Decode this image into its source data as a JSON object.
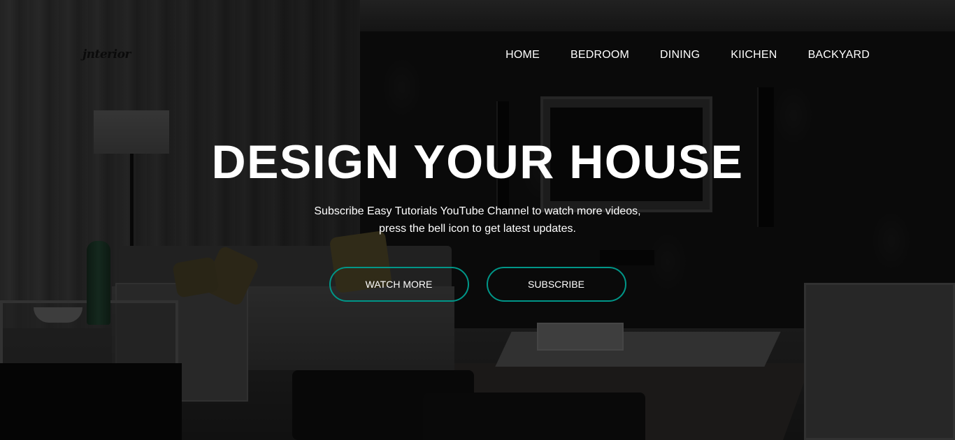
{
  "header": {
    "logo_text": "jnterior",
    "nav": [
      {
        "label": "HOME"
      },
      {
        "label": "BEDROOM"
      },
      {
        "label": "DINING"
      },
      {
        "label": "KIICHEN"
      },
      {
        "label": "BACKYARD"
      }
    ]
  },
  "hero": {
    "title": "DESIGN YOUR HOUSE",
    "subtitle_line1": "Subscribe Easy Tutorials YouTube Channel to watch more videos,",
    "subtitle_line2": "press the bell icon to get latest updates.",
    "buttons": {
      "watch_more": "WATCH MORE",
      "subscribe": "SUBSCRIBE"
    }
  },
  "colors": {
    "accent": "#009688",
    "text": "#ffffff",
    "overlay": "rgba(0,0,0,0.55)"
  }
}
